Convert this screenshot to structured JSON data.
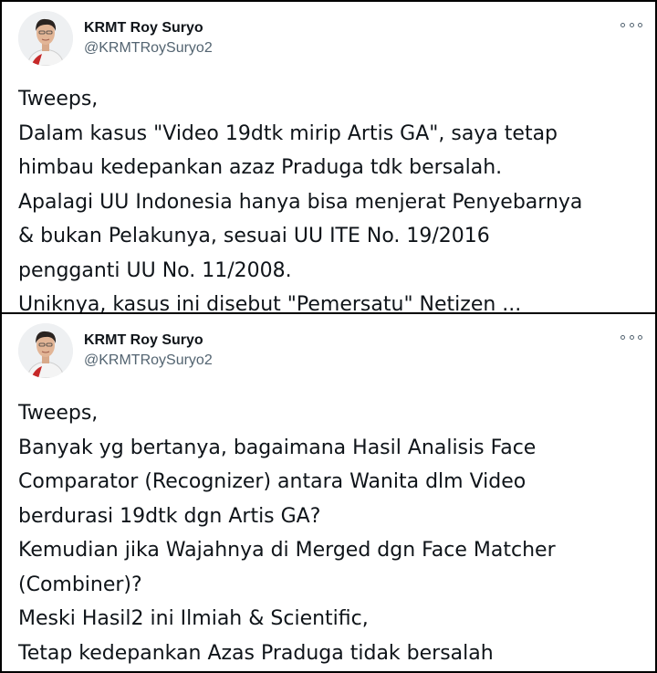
{
  "tweets": [
    {
      "author": {
        "name": "KRMT Roy Suryo",
        "handle": "@KRMTRoySuryo2"
      },
      "more_icon": "more-horizontal-icon",
      "lines": [
        "Tweeps,",
        "Dalam kasus \"Video 19dtk mirip Artis GA\", saya tetap",
        "himbau kedepankan azaz Praduga tdk bersalah.",
        "Apalagi UU Indonesia hanya bisa menjerat Penyebarnya",
        "& bukan Pelakunya, sesuai UU ITE No. 19/2016",
        "pengganti UU No. 11/2008.",
        "Uniknya, kasus ini disebut \"Pemersatu\" Netizen ..."
      ]
    },
    {
      "author": {
        "name": "KRMT Roy Suryo",
        "handle": "@KRMTRoySuryo2"
      },
      "more_icon": "more-horizontal-icon",
      "lines": [
        "Tweeps,",
        "Banyak yg bertanya, bagaimana Hasil Analisis Face",
        "Comparator (Recognizer) antara Wanita dlm Video",
        "berdurasi 19dtk dgn Artis GA?",
        "Kemudian jika Wajahnya di Merged dgn Face Matcher",
        "(Combiner)?",
        "Meski Hasil2 ini Ilmiah & Scientific,",
        "Tetap kedepankan Azas Praduga tidak bersalah"
      ]
    }
  ],
  "colors": {
    "text": "#0f1419",
    "secondary": "#536471",
    "accent": "#1d9bf0",
    "frame_border": "#000000"
  }
}
